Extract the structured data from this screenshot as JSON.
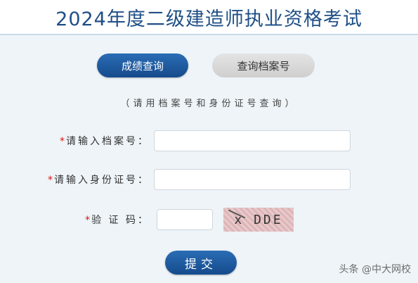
{
  "header": {
    "title": "2024年度二级建造师执业资格考试"
  },
  "tabs": [
    {
      "label": "成绩查询",
      "active": true
    },
    {
      "label": "查询档案号",
      "active": false
    }
  ],
  "form": {
    "hint": "（请用档案号和身份证号查询）",
    "required_mark": "*",
    "archive_label": "请输入档案号：",
    "archive_value": "",
    "id_label": "请输入身份证号：",
    "id_value": "",
    "captcha_label": "验 证 码：",
    "captcha_value": "",
    "captcha_text": "x DDE",
    "submit_label": "提交"
  },
  "watermark": "头条 @中大网校",
  "colors": {
    "accent": "#1f5ea5",
    "title": "#1f4f86",
    "required": "#dd1111"
  }
}
